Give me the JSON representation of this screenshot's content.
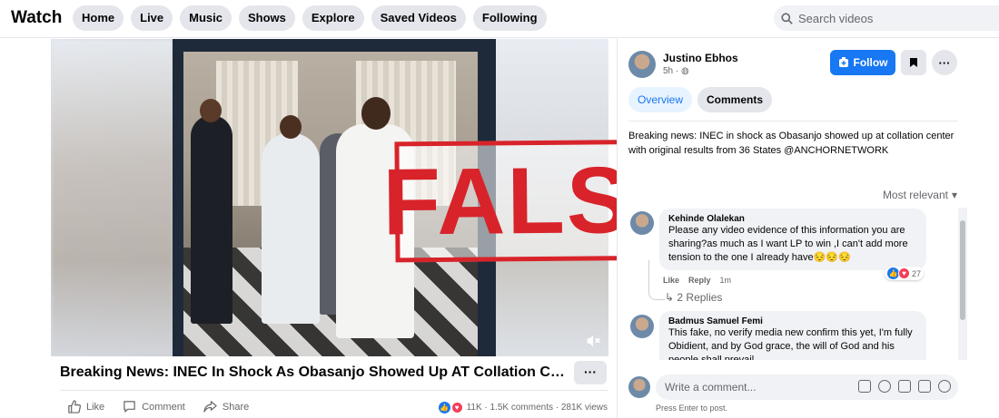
{
  "header": {
    "brand": "Watch",
    "nav": [
      "Home",
      "Live",
      "Music",
      "Shows",
      "Explore",
      "Saved Videos",
      "Following"
    ],
    "search_placeholder": "Search videos"
  },
  "video": {
    "stamp": "FALSE",
    "title": "Breaking News: INEC In Shock As Obasanjo Showed Up AT Collation Ce...",
    "more": "···",
    "actions": {
      "like": "Like",
      "comment": "Comment",
      "share": "Share"
    },
    "stats": "11K · 1.5K comments · 281K views"
  },
  "post": {
    "author": "Justino Ebhos",
    "meta": "5h ·",
    "follow": "Follow",
    "tabs": [
      "Overview",
      "Comments"
    ],
    "description": "Breaking news: INEC in shock as Obasanjo showed up at collation center with original results from 36 States @ANCHORNETWORK",
    "sort": "Most relevant"
  },
  "comments": [
    {
      "name": "Kehinde Olalekan",
      "text": "Please any video evidence of this information you are sharing?as much as I want LP to win ,I can't add more tension to the one I already have😔😔😔",
      "like": "Like",
      "reply": "Reply",
      "time": "1m",
      "reactions": "27",
      "replies": "↳ 2 Replies"
    },
    {
      "name": "Badmus Samuel Femi",
      "text": "This fake, no verify media new confirm this yet, I'm fully Obidient, and by God grace, the will of God and his people shall prevail"
    }
  ],
  "composer": {
    "placeholder": "Write a comment...",
    "hint": "Press Enter to post."
  },
  "colors": {
    "accent": "#1877f2",
    "stamp": "#d8232a",
    "love": "#f33e58"
  }
}
